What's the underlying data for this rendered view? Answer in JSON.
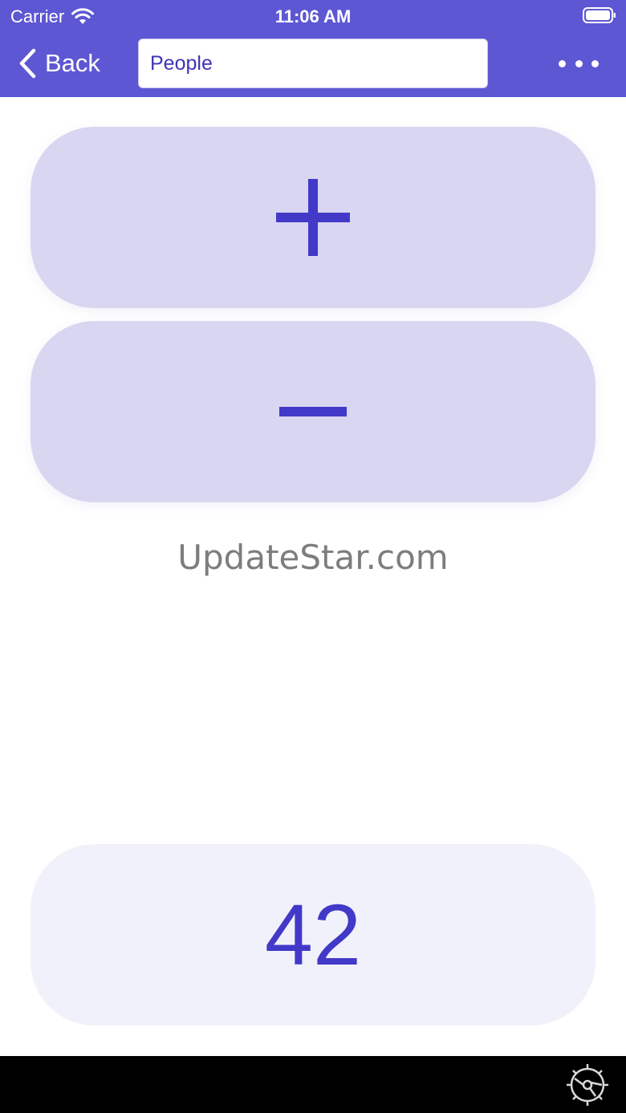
{
  "status_bar": {
    "carrier": "Carrier",
    "time": "11:06 AM",
    "wifi_icon": "wifi-icon",
    "battery_icon": "battery-icon"
  },
  "nav": {
    "back_label": "Back",
    "search_value": "People",
    "more_icon": "ellipsis-icon"
  },
  "buttons": {
    "plus_icon": "plus-icon",
    "minus_icon": "minus-icon"
  },
  "watermark": "UpdateStar.com",
  "counter": {
    "value": "42"
  },
  "bottom_bar": {
    "settings_icon": "gear-icon"
  },
  "colors": {
    "header": "#5e57d3",
    "button_bg": "#d9d6f1",
    "accent": "#4239c8",
    "counter_bg": "#f1f1fb"
  }
}
